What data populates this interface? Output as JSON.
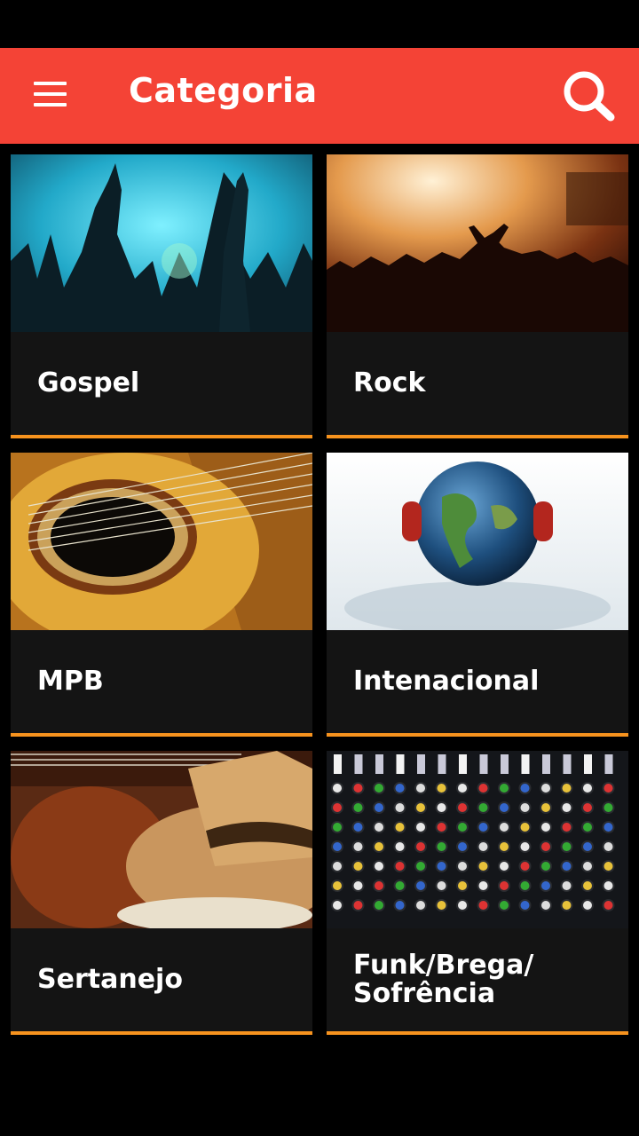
{
  "app_bar": {
    "title": "Categoria",
    "menu_icon": "hamburger-menu-icon",
    "search_icon": "search-icon",
    "color": "#f44336"
  },
  "accent_color": "#f7931e",
  "categories": [
    {
      "label": "Gospel"
    },
    {
      "label": "Rock"
    },
    {
      "label": "MPB"
    },
    {
      "label": "Intenacional"
    },
    {
      "label": "Sertanejo"
    },
    {
      "label": "Funk/Brega/ Sofrência"
    }
  ]
}
